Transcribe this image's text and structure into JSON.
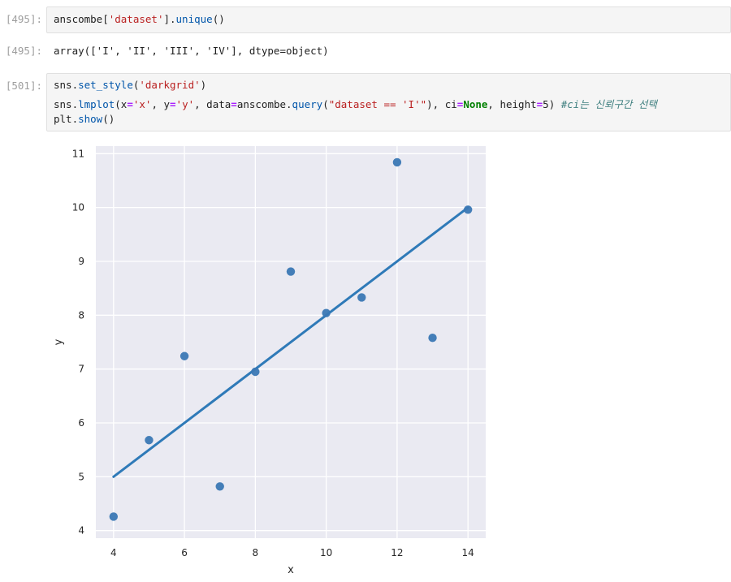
{
  "cells": [
    {
      "prompt": "[495]:",
      "code": {
        "var": "anscombe[",
        "str": "'dataset'",
        "rest": "].",
        "fn": "unique",
        "end": "()"
      }
    },
    {
      "prompt": "[495]:",
      "output": "array(['I', 'II', 'III', 'IV'], dtype=object)"
    },
    {
      "prompt": "[501]:",
      "line1": {
        "a": "sns.",
        "fn": "set_style",
        "b": "(",
        "str": "'darkgrid'",
        "c": ")"
      },
      "line2": {
        "a": "sns.",
        "fn1": "lmplot",
        "b": "(x",
        "eq1": "=",
        "s1": "'x'",
        "c": ", y",
        "eq2": "=",
        "s2": "'y'",
        "d": ", data",
        "eq3": "=",
        "e": "anscombe.",
        "fn2": "query",
        "f": "(",
        "s3": "\"dataset == 'I'\"",
        "g": "), ci",
        "eq4": "=",
        "kw": "None",
        "h": ", height",
        "eq5": "=",
        "i": "5) ",
        "comment": "#ci는 신뢰구간 선택"
      },
      "line3": {
        "a": "plt.",
        "fn": "show",
        "b": "()"
      }
    }
  ],
  "chart_data": {
    "type": "scatter",
    "style": "darkgrid",
    "xlabel": "x",
    "ylabel": "y",
    "xlim": [
      3.5,
      14.5
    ],
    "ylim": [
      3.86,
      11.14
    ],
    "xticks": [
      4,
      6,
      8,
      10,
      12,
      14
    ],
    "yticks": [
      4,
      5,
      6,
      7,
      8,
      9,
      10,
      11
    ],
    "points": [
      {
        "x": 4,
        "y": 4.26
      },
      {
        "x": 5,
        "y": 5.68
      },
      {
        "x": 6,
        "y": 7.24
      },
      {
        "x": 7,
        "y": 4.82
      },
      {
        "x": 8,
        "y": 6.95
      },
      {
        "x": 9,
        "y": 8.81
      },
      {
        "x": 10,
        "y": 8.04
      },
      {
        "x": 11,
        "y": 8.33
      },
      {
        "x": 12,
        "y": 10.84
      },
      {
        "x": 13,
        "y": 7.58
      },
      {
        "x": 14,
        "y": 9.96
      }
    ],
    "regression": {
      "x": [
        4,
        14
      ],
      "y": [
        5.0,
        10.0
      ]
    },
    "grid": true,
    "colors": {
      "point": "#3b78b4",
      "line": "#2f7ab8",
      "background": "#eaeaf2",
      "grid": "#ffffff"
    }
  }
}
